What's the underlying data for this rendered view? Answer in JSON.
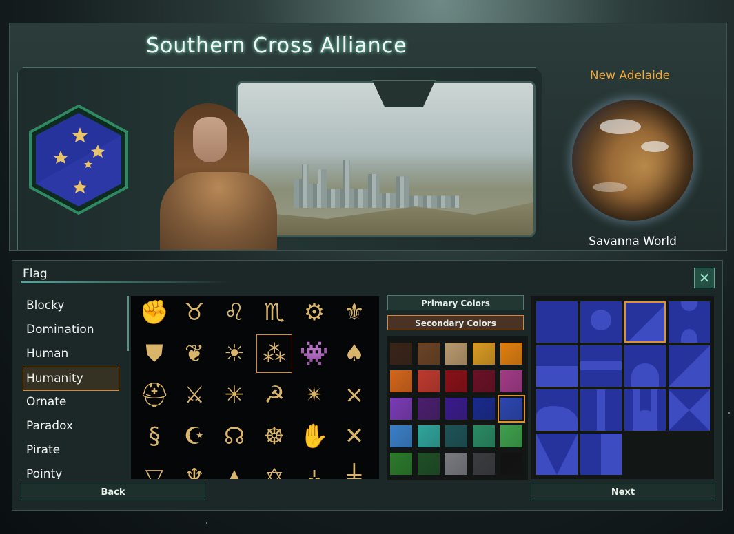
{
  "header": {
    "title": "Southern Cross Alliance"
  },
  "planet": {
    "name": "New Adelaide",
    "type": "Savanna World"
  },
  "section": {
    "title": "Flag",
    "close_icon": "close-x-icon"
  },
  "categories": {
    "items": [
      "Blocky",
      "Domination",
      "Human",
      "Humanity",
      "Ornate",
      "Paradox",
      "Pirate",
      "Pointy"
    ],
    "selected": "Humanity"
  },
  "symbols": [
    {
      "icon": "raised-fist-icon",
      "glyph": "✊"
    },
    {
      "icon": "bull-head-icon",
      "glyph": "♉"
    },
    {
      "icon": "lion-head-icon",
      "glyph": "♌"
    },
    {
      "icon": "scorpion-icon",
      "glyph": "♏"
    },
    {
      "icon": "cogwheel-icon",
      "glyph": "⚙"
    },
    {
      "icon": "fleur-de-lis-icon",
      "glyph": "⚜"
    },
    {
      "icon": "eagle-shield-icon",
      "glyph": "⛊"
    },
    {
      "icon": "fern-leaf-icon",
      "glyph": "❦"
    },
    {
      "icon": "lion-face-icon",
      "glyph": "☀"
    },
    {
      "icon": "southern-cross-stars-icon",
      "glyph": "⁂"
    },
    {
      "icon": "space-invader-icon",
      "glyph": "👾"
    },
    {
      "icon": "spade-icon",
      "glyph": "♠"
    },
    {
      "icon": "spartan-helmet-icon",
      "glyph": "⛑"
    },
    {
      "icon": "winged-dagger-icon",
      "glyph": "⚔"
    },
    {
      "icon": "spider-icon",
      "glyph": "✳"
    },
    {
      "icon": "hammer-sickle-icon",
      "glyph": "☭"
    },
    {
      "icon": "compass-star-icon",
      "glyph": "✴"
    },
    {
      "icon": "confederate-cross-icon",
      "glyph": "⨯"
    },
    {
      "icon": "snake-s-icon",
      "glyph": "§"
    },
    {
      "icon": "arabic-calligraphy-icon",
      "glyph": "☪"
    },
    {
      "icon": "horseshoe-star-icon",
      "glyph": "☊"
    },
    {
      "icon": "triquetra-icon",
      "glyph": "☸"
    },
    {
      "icon": "hand-icon",
      "glyph": "✋"
    },
    {
      "icon": "union-jack-icon",
      "glyph": "✕"
    },
    {
      "icon": "partial-symbol-icon",
      "glyph": "▽"
    },
    {
      "icon": "partial-symbol-icon",
      "glyph": "♆"
    },
    {
      "icon": "partial-symbol-icon",
      "glyph": "▲"
    },
    {
      "icon": "partial-symbol-icon",
      "glyph": "✡"
    },
    {
      "icon": "partial-symbol-icon",
      "glyph": "⚶"
    },
    {
      "icon": "partial-symbol-icon",
      "glyph": "╪"
    }
  ],
  "selected_symbol": "southern-cross-stars-icon",
  "colors": {
    "primary_label": "Primary Colors",
    "secondary_label": "Secondary Colors",
    "active_tab": "Secondary Colors",
    "swatches": [
      "#3a2418",
      "#6b4325",
      "#b8996d",
      "#d99a22",
      "#e07f10",
      "#d4651b",
      "#c0392e",
      "#8a0f17",
      "#6b1025",
      "#a33a87",
      "#7a3bb5",
      "#4b1f6f",
      "#3a1a8c",
      "#1a2a8c",
      "#2b46b0",
      "#3a7fc8",
      "#2fa59c",
      "#1d5357",
      "#2a8a63",
      "#3ea04b",
      "#2b7a2b",
      "#1f4f25",
      "#7a7a80",
      "#3c3c40",
      "#121212"
    ],
    "selected": "#2b46b0"
  },
  "patterns": {
    "items": [
      "solid",
      "circle",
      "diagonal",
      "two-circles",
      "stripe-bottom",
      "stripe-middle",
      "half-dome",
      "diagonal-lower",
      "wave",
      "vertical-bar",
      "helm",
      "bowtie",
      "v-notch",
      "vertical-split"
    ],
    "selected": "diagonal"
  },
  "buttons": {
    "back": "Back",
    "next": "Next"
  },
  "emblem": {
    "icon": "southern-cross-flag-icon",
    "background": "#27339c",
    "star_color": "#e8c36a"
  }
}
